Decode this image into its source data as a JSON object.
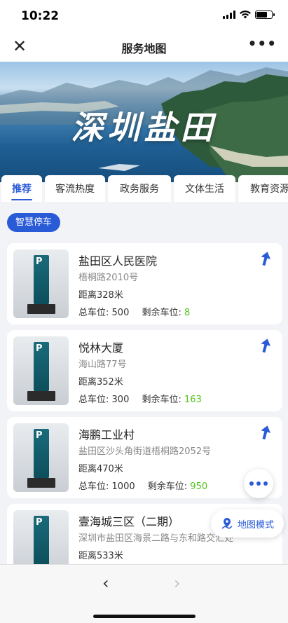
{
  "status": {
    "time": "10:22"
  },
  "nav": {
    "title": "服务地图",
    "close_icon": "close-icon",
    "more_icon": "more-icon"
  },
  "hero": {
    "title": "深圳盐田"
  },
  "tabs": [
    {
      "label": "推荐",
      "active": true
    },
    {
      "label": "客流热度",
      "active": false
    },
    {
      "label": "政务服务",
      "active": false
    },
    {
      "label": "文体生活",
      "active": false
    },
    {
      "label": "教育资源",
      "active": false
    }
  ],
  "filter": {
    "chip_label": "智慧停车"
  },
  "parking": [
    {
      "name": "盐田区人民医院",
      "address": "梧桐路2010号",
      "distance": "距离328米",
      "total_label": "总车位:",
      "total": "500",
      "remaining_label": "剩余车位:",
      "remaining": "8"
    },
    {
      "name": "悦林大厦",
      "address": "海山路77号",
      "distance": "距离352米",
      "total_label": "总车位:",
      "total": "300",
      "remaining_label": "剩余车位:",
      "remaining": "163"
    },
    {
      "name": "海鹏工业村",
      "address": "盐田区沙头角街道梧桐路2052号",
      "distance": "距离470米",
      "total_label": "总车位:",
      "total": "1000",
      "remaining_label": "剩余车位:",
      "remaining": "950"
    },
    {
      "name": "壹海城三区（二期）",
      "address": "深圳市盐田区海景二路与东和路交汇处",
      "distance": "距离533米",
      "total_label": "",
      "total": "",
      "remaining_label": "",
      "remaining": ""
    }
  ],
  "floating": {
    "map_mode_label": "地图模式"
  },
  "colors": {
    "accent": "#2a5bd7",
    "remaining": "#52c41a"
  }
}
